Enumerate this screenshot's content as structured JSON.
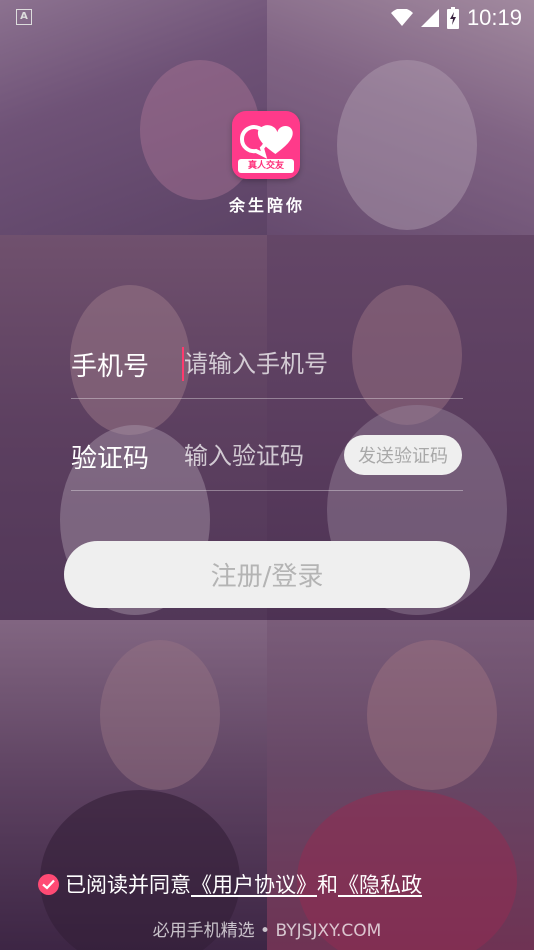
{
  "status_bar": {
    "left_icon_letter": "A",
    "icons": [
      "wifi-icon",
      "signal-icon",
      "battery-icon"
    ],
    "time": "10:19"
  },
  "app": {
    "logo_icon": "chat-bubbles-icon",
    "logo_badge": "真人交友",
    "name": "余生陪你",
    "brand_color": "#ff3a8a"
  },
  "form": {
    "phone_label": "手机号",
    "phone_placeholder": "请输入手机号",
    "phone_value": "",
    "code_label": "验证码",
    "code_placeholder": "输入验证码",
    "code_value": "",
    "send_code_label": "发送验证码"
  },
  "login_button": {
    "label": "注册/登录"
  },
  "agreement": {
    "checked": true,
    "prefix": "已阅读并同意",
    "user_agreement": "《用户协议》",
    "and": "和",
    "privacy_policy": "《隐私政"
  },
  "watermark": "必用手机精选 • BYJSJXY.COM",
  "colors": {
    "accent": "#ff4a74",
    "button_bg": "#efefef",
    "button_text": "#b4b4b4"
  }
}
